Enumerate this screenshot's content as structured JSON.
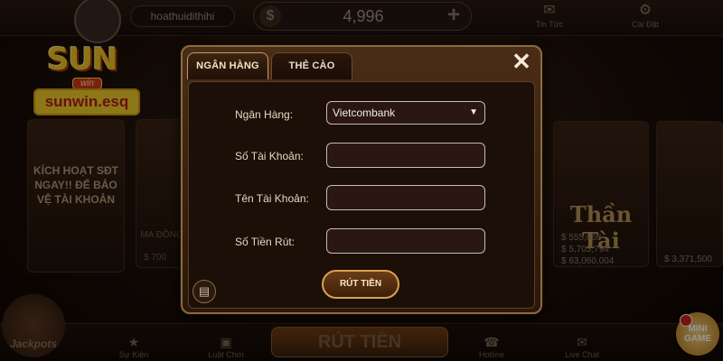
{
  "header": {
    "username": "hoathuidithihi",
    "balance_symbol": "$",
    "balance": "4,996",
    "add_symbol": "+",
    "news_label": "Tin Tức",
    "settings_label": "Cài Đặt"
  },
  "brand": {
    "logo_text": "SUN",
    "logo_sub": "win",
    "domain": "sunwin.esq"
  },
  "lobby": {
    "promo_text": "KÍCH HOẠT SĐT NGAY!! ĐỂ BẢO VỆ TÀI KHOẢN",
    "game2_caption": "MA ĐỒNG",
    "game2_stat": "$ 700",
    "game3_title": "Thần Tài",
    "game3_stats": [
      "$ 555,068",
      "$ 5,703,794",
      "$ 63,060,004"
    ],
    "game4_stat": "$ 3,371,500"
  },
  "bottom_nav": {
    "events": "Sự Kiện",
    "law": "Luật Chơi",
    "withdraw": "RÚT TIỀN",
    "hotline": "Hotline",
    "livechat": "Live Chat",
    "jackpot": "Jackpots",
    "minigame": "MINI GAME"
  },
  "modal": {
    "tabs": [
      {
        "label": "NGÂN HÀNG",
        "active": true
      },
      {
        "label": "THẺ CÀO",
        "active": false
      }
    ],
    "close_symbol": "✕",
    "fields": {
      "bank_label": "Ngân Hàng:",
      "bank_value": "Vietcombank",
      "account_number_label": "Số Tài Khoản:",
      "account_number_value": "",
      "account_name_label": "Tên Tài Khoản:",
      "account_name_value": "",
      "amount_label": "Số Tiền Rút:",
      "amount_value": ""
    },
    "submit_label": "RÚT TIỀN",
    "history_icon_glyph": "▤"
  },
  "colors": {
    "accent_gold": "#d8a24f",
    "modal_bg": "#1b0f07",
    "brand_yellow": "#f3cf2c",
    "brand_red": "#b61c1c"
  },
  "icons": [
    "dollar-icon",
    "plus-icon",
    "news-icon",
    "gear-icon",
    "close-icon",
    "chevron-down-icon",
    "history-icon"
  ]
}
